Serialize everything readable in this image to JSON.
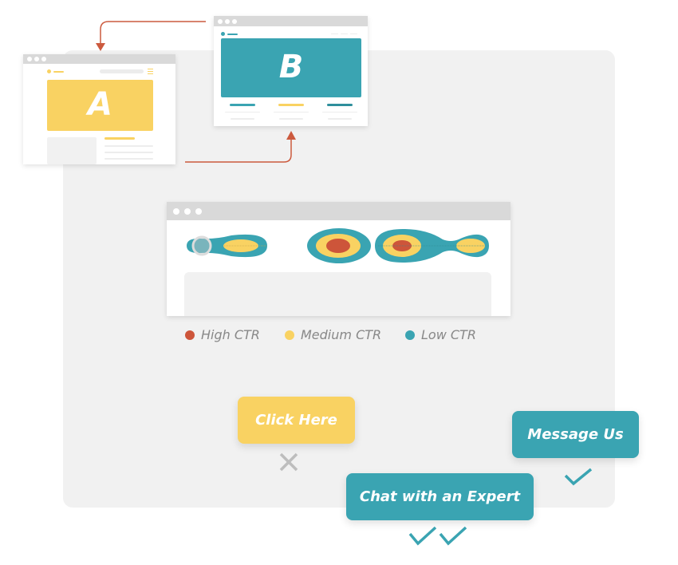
{
  "colors": {
    "teal": "#3aa4b2",
    "yellow": "#f9d262",
    "red": "#cd553a",
    "arrow": "#cc5a3e",
    "gray_panel": "#f1f1f1",
    "titlebar": "#d9d9d9"
  },
  "ab_test": {
    "variant_a": {
      "label": "A"
    },
    "variant_b": {
      "label": "B"
    }
  },
  "heatmap": {
    "legend": [
      {
        "label": "High CTR",
        "color": "#cd553a"
      },
      {
        "label": "Medium CTR",
        "color": "#f9d262"
      },
      {
        "label": "Low CTR",
        "color": "#3aa4b2"
      }
    ]
  },
  "ctas": {
    "click_here": {
      "label": "Click Here",
      "result_icon": "x-icon"
    },
    "message_us": {
      "label": "Message Us",
      "result_icon": "check-icon"
    },
    "chat_expert": {
      "label": "Chat with an Expert",
      "result_icon": "double-check-icon"
    }
  }
}
